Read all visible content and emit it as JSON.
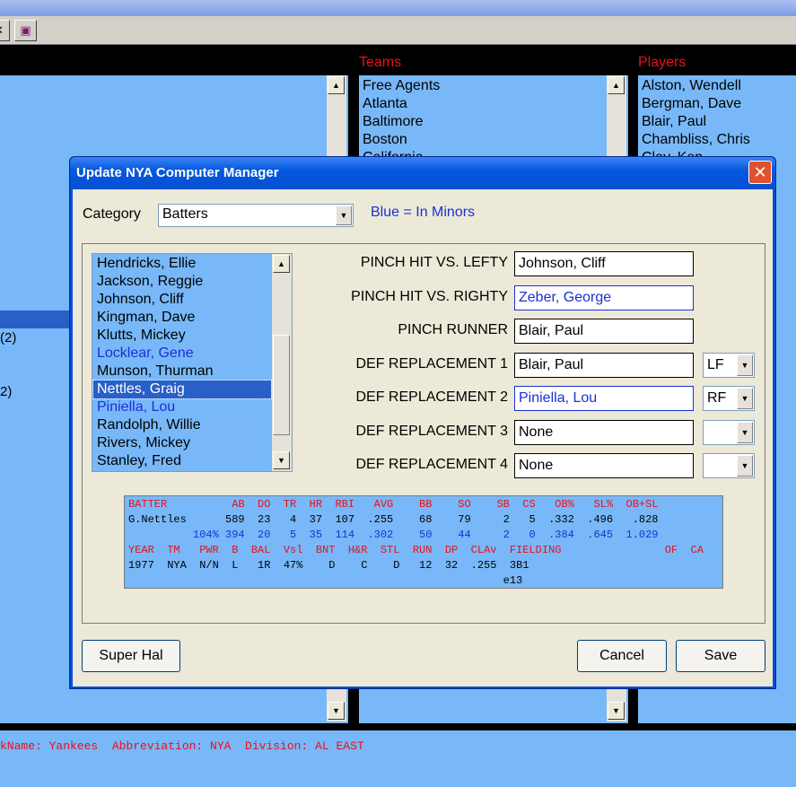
{
  "toolbar": {
    "buttons": [
      {
        "icon": "close-icon",
        "glyph": "✕"
      },
      {
        "icon": "book-icon",
        "glyph": "▣"
      }
    ]
  },
  "background": {
    "teams_header": "Teams",
    "players_header": "Players",
    "teams": [
      "Free Agents",
      "Atlanta",
      "Baltimore",
      "Boston",
      "California"
    ],
    "players": [
      "Alston, Wendell",
      "Bergman, Dave",
      "Blair, Paul",
      "Chambliss, Chris",
      "Clay, Ken"
    ],
    "left_fragments": [
      "(2)",
      "2)"
    ]
  },
  "status_bar": {
    "text": "kName: Yankees  Abbreviation: NYA  Division: AL EAST"
  },
  "dialog": {
    "title": "Update NYA Computer Manager",
    "category_label": "Category",
    "category_value": "Batters",
    "legend": "Blue = In Minors",
    "players": [
      {
        "name": "Hendricks, Ellie",
        "minors": false,
        "selected": false
      },
      {
        "name": "Jackson, Reggie",
        "minors": false,
        "selected": false
      },
      {
        "name": "Johnson, Cliff",
        "minors": false,
        "selected": false
      },
      {
        "name": "Kingman, Dave",
        "minors": false,
        "selected": false
      },
      {
        "name": "Klutts, Mickey",
        "minors": false,
        "selected": false
      },
      {
        "name": "Locklear, Gene",
        "minors": true,
        "selected": false
      },
      {
        "name": "Munson, Thurman",
        "minors": false,
        "selected": false
      },
      {
        "name": "Nettles, Graig",
        "minors": false,
        "selected": true
      },
      {
        "name": "Piniella, Lou",
        "minors": true,
        "selected": false
      },
      {
        "name": "Randolph, Willie",
        "minors": false,
        "selected": false
      },
      {
        "name": "Rivers, Mickey",
        "minors": false,
        "selected": false
      },
      {
        "name": "Stanley, Fred",
        "minors": false,
        "selected": false
      }
    ],
    "fields": [
      {
        "label": "PINCH HIT VS. LEFTY",
        "value": "Johnson, Cliff",
        "minors": false,
        "position": null
      },
      {
        "label": "PINCH HIT VS. RIGHTY",
        "value": "Zeber, George",
        "minors": true,
        "position": null
      },
      {
        "label": "PINCH RUNNER",
        "value": "Blair, Paul",
        "minors": false,
        "position": null
      },
      {
        "label": "DEF REPLACEMENT 1",
        "value": "Blair, Paul",
        "minors": false,
        "position": "LF"
      },
      {
        "label": "DEF REPLACEMENT 2",
        "value": "Piniella, Lou",
        "minors": true,
        "position": "RF"
      },
      {
        "label": "DEF REPLACEMENT 3",
        "value": "None",
        "minors": false,
        "position": ""
      },
      {
        "label": "DEF REPLACEMENT 4",
        "value": "None",
        "minors": false,
        "position": ""
      }
    ],
    "stats": {
      "header1": "BATTER          AB  DO  TR  HR  RBI   AVG    BB    SO    SB  CS   OB%   SL%  OB+SL",
      "line1": "G.Nettles      589  23   4  37  107  .255    68    79     2   5  .332  .496   .828",
      "line2": "          104% 394  20   5  35  114  .302    50    44     2   0  .384  .645  1.029",
      "header2": "YEAR  TM   PWR  B  BAL  Vsl  BNT  H&R  STL  RUN  DP  CLAv  FIELDING                OF  CA",
      "line3": "1977  NYA  N/N  L   1R  47%    D    C    D   12  32  .255  3B1",
      "line4": "                                                          e13"
    },
    "buttons": {
      "super_hal": "Super Hal",
      "cancel": "Cancel",
      "save": "Save"
    }
  }
}
